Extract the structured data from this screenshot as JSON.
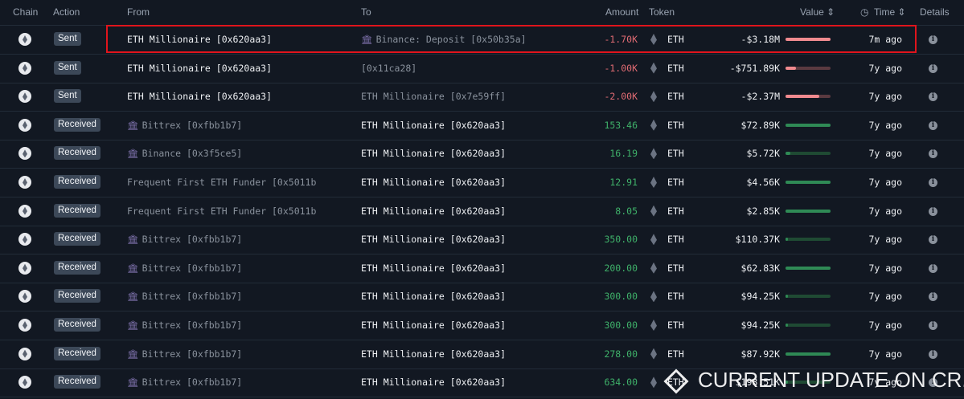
{
  "header": {
    "chain": "Chain",
    "action": "Action",
    "from": "From",
    "to": "To",
    "amount": "Amount",
    "token": "Token",
    "value": "Value ⇕",
    "time": "Time ⇕",
    "details": "Details",
    "clock_icon": "clock-icon"
  },
  "colors": {
    "negative": "#e06b73",
    "positive": "#3fb26a",
    "highlight": "#e0141c"
  },
  "rows": [
    {
      "action": "Sent",
      "from": "ETH Millionaire [0x620aa3]",
      "from_entity": false,
      "from_dim": false,
      "to": "Binance: Deposit [0x50b35a]",
      "to_entity": true,
      "to_dim": true,
      "amount": "-1.70K",
      "token": "ETH",
      "value": "-$3.18M",
      "bar": 1.0,
      "time": "7m ago"
    },
    {
      "action": "Sent",
      "from": "ETH Millionaire [0x620aa3]",
      "from_entity": false,
      "from_dim": false,
      "to": "[0x11ca28]",
      "to_entity": false,
      "to_dim": true,
      "amount": "-1.00K",
      "token": "ETH",
      "value": "-$751.89K",
      "bar": 0.24,
      "time": "7y ago"
    },
    {
      "action": "Sent",
      "from": "ETH Millionaire [0x620aa3]",
      "from_entity": false,
      "from_dim": false,
      "to": "ETH Millionaire [0x7e59ff]",
      "to_entity": false,
      "to_dim": true,
      "amount": "-2.00K",
      "token": "ETH",
      "value": "-$2.37M",
      "bar": 0.75,
      "time": "7y ago"
    },
    {
      "action": "Received",
      "from": "Bittrex [0xfbb1b7]",
      "from_entity": true,
      "from_dim": true,
      "to": "ETH Millionaire [0x620aa3]",
      "to_entity": false,
      "to_dim": false,
      "amount": "153.46",
      "token": "ETH",
      "value": "$72.89K",
      "bar": 1.0,
      "time": "7y ago"
    },
    {
      "action": "Received",
      "from": "Binance [0x3f5ce5]",
      "from_entity": true,
      "from_dim": true,
      "to": "ETH Millionaire [0x620aa3]",
      "to_entity": false,
      "to_dim": false,
      "amount": "16.19",
      "token": "ETH",
      "value": "$5.72K",
      "bar": 0.1,
      "time": "7y ago"
    },
    {
      "action": "Received",
      "from": "Frequent First ETH Funder [0x5011b",
      "from_entity": false,
      "from_dim": true,
      "to": "ETH Millionaire [0x620aa3]",
      "to_entity": false,
      "to_dim": false,
      "amount": "12.91",
      "token": "ETH",
      "value": "$4.56K",
      "bar": 1.0,
      "time": "7y ago"
    },
    {
      "action": "Received",
      "from": "Frequent First ETH Funder [0x5011b",
      "from_entity": false,
      "from_dim": true,
      "to": "ETH Millionaire [0x620aa3]",
      "to_entity": false,
      "to_dim": false,
      "amount": "8.05",
      "token": "ETH",
      "value": "$2.85K",
      "bar": 1.0,
      "time": "7y ago"
    },
    {
      "action": "Received",
      "from": "Bittrex [0xfbb1b7]",
      "from_entity": true,
      "from_dim": true,
      "to": "ETH Millionaire [0x620aa3]",
      "to_entity": false,
      "to_dim": false,
      "amount": "350.00",
      "token": "ETH",
      "value": "$110.37K",
      "bar": 0.05,
      "time": "7y ago"
    },
    {
      "action": "Received",
      "from": "Bittrex [0xfbb1b7]",
      "from_entity": true,
      "from_dim": true,
      "to": "ETH Millionaire [0x620aa3]",
      "to_entity": false,
      "to_dim": false,
      "amount": "200.00",
      "token": "ETH",
      "value": "$62.83K",
      "bar": 1.0,
      "time": "7y ago"
    },
    {
      "action": "Received",
      "from": "Bittrex [0xfbb1b7]",
      "from_entity": true,
      "from_dim": true,
      "to": "ETH Millionaire [0x620aa3]",
      "to_entity": false,
      "to_dim": false,
      "amount": "300.00",
      "token": "ETH",
      "value": "$94.25K",
      "bar": 0.05,
      "time": "7y ago"
    },
    {
      "action": "Received",
      "from": "Bittrex [0xfbb1b7]",
      "from_entity": true,
      "from_dim": true,
      "to": "ETH Millionaire [0x620aa3]",
      "to_entity": false,
      "to_dim": false,
      "amount": "300.00",
      "token": "ETH",
      "value": "$94.25K",
      "bar": 0.05,
      "time": "7y ago"
    },
    {
      "action": "Received",
      "from": "Bittrex [0xfbb1b7]",
      "from_entity": true,
      "from_dim": true,
      "to": "ETH Millionaire [0x620aa3]",
      "to_entity": false,
      "to_dim": false,
      "amount": "278.00",
      "token": "ETH",
      "value": "$87.92K",
      "bar": 1.0,
      "time": "7y ago"
    },
    {
      "action": "Received",
      "from": "Bittrex [0xfbb1b7]",
      "from_entity": true,
      "from_dim": true,
      "to": "ETH Millionaire [0x620aa3]",
      "to_entity": false,
      "to_dim": false,
      "amount": "634.00",
      "token": "ETH",
      "value": "$198.51K",
      "bar": 0.05,
      "time": "7y ago"
    }
  ],
  "watermark": "CURRENT UPDATE ON CR..."
}
